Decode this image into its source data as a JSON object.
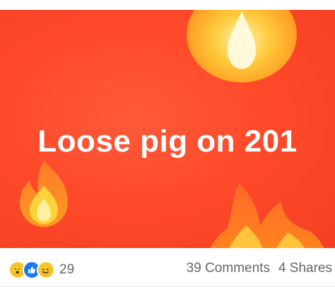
{
  "post": {
    "headline": "Loose pig on 201",
    "background_color": "#f7472a"
  },
  "reactions": {
    "icons": [
      "wow-face",
      "like-thumb",
      "haha-face"
    ],
    "count": "29"
  },
  "stats": {
    "comments": "39 Comments",
    "shares": "4 Shares"
  }
}
